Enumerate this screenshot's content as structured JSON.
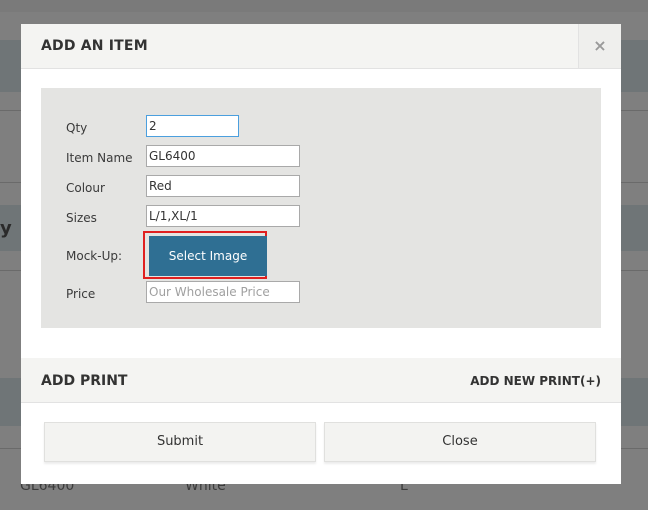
{
  "background": {
    "row_item": "GL6400",
    "row_colour": "White",
    "row_size": "L",
    "partial_heading": "y"
  },
  "modal": {
    "title": "ADD AN ITEM",
    "close_glyph": "×",
    "form": {
      "qty": {
        "label": "Qty",
        "value": "2"
      },
      "item_name": {
        "label": "Item Name",
        "value": "GL6400"
      },
      "colour": {
        "label": "Colour",
        "value": "Red"
      },
      "sizes": {
        "label": "Sizes",
        "value": "L/1,XL/1"
      },
      "mockup": {
        "label": "Mock-Up:",
        "button_label": "Select Image"
      },
      "price": {
        "label": "Price",
        "value": "",
        "placeholder": "Our Wholesale Price"
      }
    },
    "print_section": {
      "title": "ADD PRINT",
      "add_link": "ADD NEW PRINT(+)"
    },
    "footer": {
      "submit_label": "Submit",
      "close_label": "Close"
    }
  }
}
